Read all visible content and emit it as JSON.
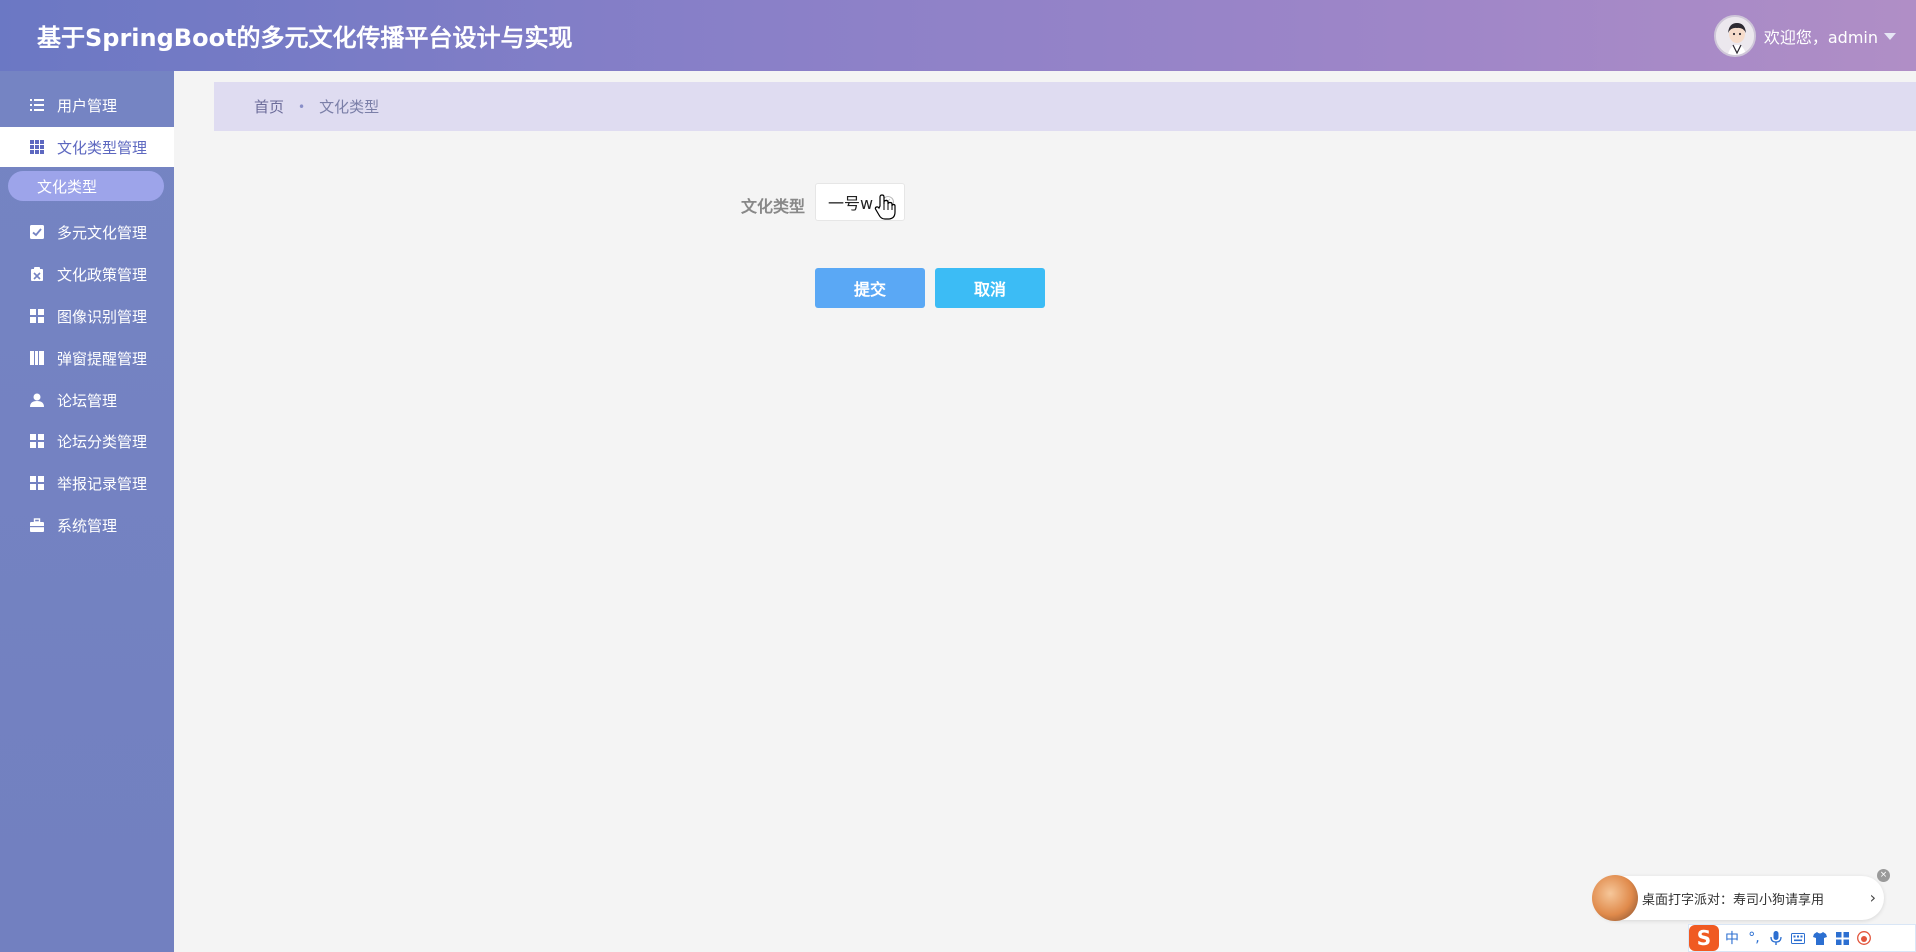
{
  "header": {
    "title": "基于SpringBoot的多元文化传播平台设计与实现",
    "welcome": "欢迎您，admin"
  },
  "sidebar": {
    "items": [
      {
        "label": "用户管理",
        "icon": "list-icon"
      },
      {
        "label": "文化类型管理",
        "icon": "grid-icon",
        "active": true
      },
      {
        "label": "多元文化管理",
        "icon": "check-square-icon"
      },
      {
        "label": "文化政策管理",
        "icon": "clipboard-icon"
      },
      {
        "label": "图像识别管理",
        "icon": "apps-icon"
      },
      {
        "label": "弹窗提醒管理",
        "icon": "book-icon"
      },
      {
        "label": "论坛管理",
        "icon": "user-icon"
      },
      {
        "label": "论坛分类管理",
        "icon": "apps-icon"
      },
      {
        "label": "举报记录管理",
        "icon": "apps-icon"
      },
      {
        "label": "系统管理",
        "icon": "briefcase-icon"
      }
    ],
    "sub_item": "文化类型"
  },
  "breadcrumb": {
    "home": "首页",
    "separator": "•",
    "current": "文化类型"
  },
  "form": {
    "label": "文化类型",
    "value": "一号w",
    "submit_label": "提交",
    "cancel_label": "取消"
  },
  "ime": {
    "promo_text": "桌面打字派对：寿司小狗请享用",
    "arrow": "›",
    "close": "×",
    "logo": "S",
    "lang": "中",
    "punct": "°,",
    "mic_icon": "mic-icon",
    "keyboard_icon": "keyboard-icon",
    "skin_icon": "shirt-icon",
    "apps_icon": "apps-icon",
    "emoji_icon": "emoji-icon"
  },
  "colors": {
    "accent": "#5d68c0",
    "submit": "#5aa8f5",
    "cancel": "#3cbcf5",
    "sidebar": "#7584c3",
    "sub_item": "#9da4ea",
    "breadcrumb_bg": "#dfdcf1"
  }
}
